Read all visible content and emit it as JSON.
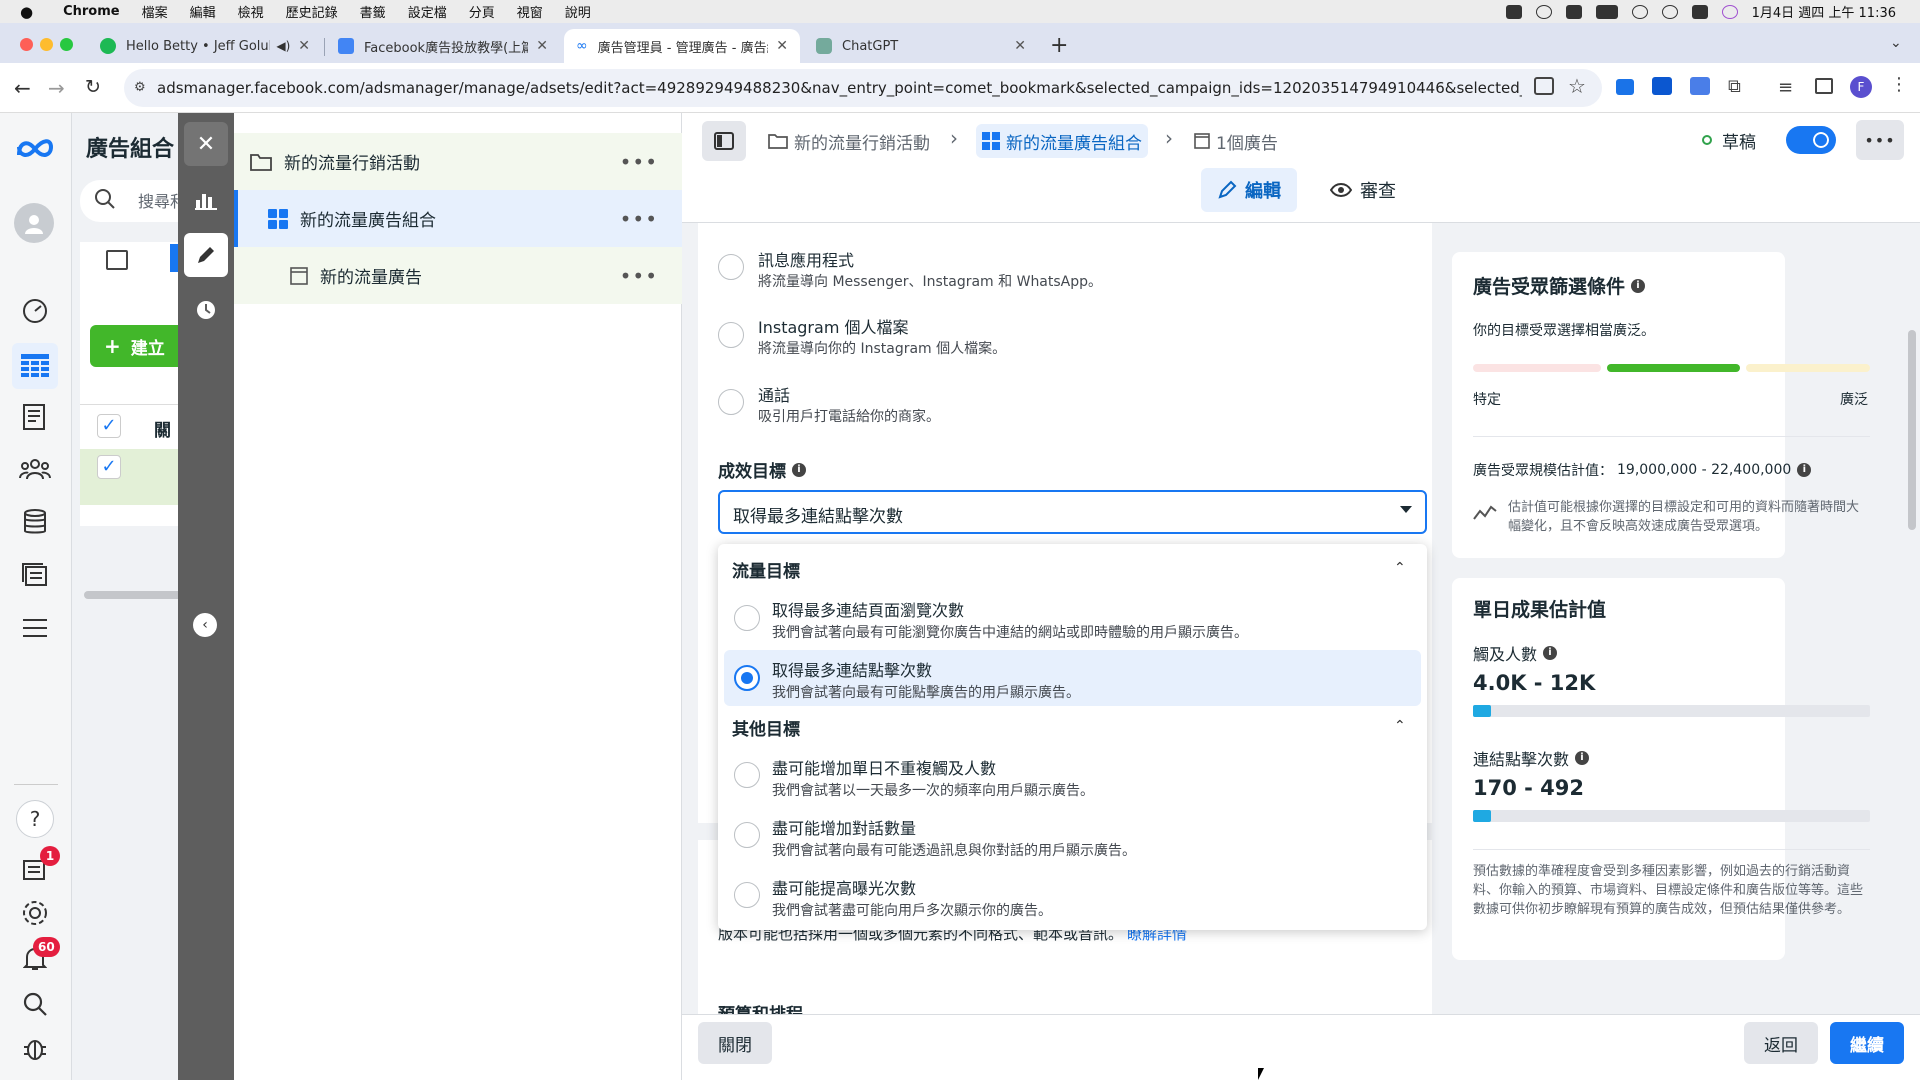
{
  "menubar": {
    "app": "Chrome",
    "items": [
      "檔案",
      "編輯",
      "檢視",
      "歷史記錄",
      "書籤",
      "設定檔",
      "分頁",
      "視窗",
      "說明"
    ],
    "datetime": "1月4日 週四 上午 11:36"
  },
  "tabs": [
    {
      "title": "Hello Betty • Jeff Golub"
    },
    {
      "title": "Facebook廣告投放教學(上篇)"
    },
    {
      "title": "廣告管理員 - 管理廣告 - 廣告組合"
    },
    {
      "title": "ChatGPT"
    }
  ],
  "address": {
    "url": "adsmanager.facebook.com/adsmanager/manage/adsets/edit?act=492892949488230&nav_entry_point=comet_bookmark&selected_campaign_ids=120203514794910446&selected_adset_ids=120203514..."
  },
  "profile_initial": "F",
  "rail": {
    "help": "?",
    "badge_notifications_small": "1",
    "badge_alerts": "60"
  },
  "background_panel": {
    "title": "廣告組合",
    "search_placeholder": "搜尋和",
    "create": "建立",
    "col": "關"
  },
  "tree": {
    "campaign": "新的流量行銷活動",
    "adset": "新的流量廣告組合",
    "ad": "新的流量廣告"
  },
  "breadcrumbs": {
    "campaign": "新的流量行銷活動",
    "adset": "新的流量廣告組合",
    "ads": "1個廣告"
  },
  "status": {
    "label": "草稿"
  },
  "modes": {
    "edit": "編輯",
    "review": "審查"
  },
  "destinations": [
    {
      "title": "訊息應用程式",
      "desc": "將流量導向 Messenger、Instagram 和 WhatsApp。"
    },
    {
      "title": "Instagram 個人檔案",
      "desc": "將流量導向你的 Instagram 個人檔案。"
    },
    {
      "title": "通話",
      "desc": "吸引用戶打電話給你的商家。"
    }
  ],
  "performance_goal": {
    "label": "成效目標",
    "selected": "取得最多連結點擊次數"
  },
  "menu": {
    "traffic_header": "流量目標",
    "traffic_options": [
      {
        "title": "取得最多連結頁面瀏覽次數",
        "desc": "我們會試著向最有可能瀏覽你廣告中連結的網站或即時體驗的用戶顯示廣告。"
      },
      {
        "title": "取得最多連結點擊次數",
        "desc": "我們會試著向最有可能點擊廣告的用戶顯示廣告。"
      }
    ],
    "other_header": "其他目標",
    "other_options": [
      {
        "title": "盡可能增加單日不重複觸及人數",
        "desc": "我們會試著以一天最多一次的頻率向用戶顯示廣告。"
      },
      {
        "title": "盡可能增加對話數量",
        "desc": "我們會試著向最有可能透過訊息與你對話的用戶顯示廣告。"
      },
      {
        "title": "盡可能提高曝光次數",
        "desc": "我們會試著盡可能向用戶多次顯示你的廣告。"
      }
    ]
  },
  "behind_text": {
    "text": "版本可能也括採用一個或多個元素的不同格式、範本或音訊。",
    "link": "瞭解詳情",
    "cut": "預算和排程"
  },
  "audience": {
    "title": "廣告受眾篩選條件",
    "subtitle": "你的目標受眾選擇相當廣泛。",
    "left": "特定",
    "right": "廣泛",
    "size_label": "廣告受眾規模估計值：",
    "size_value": "19,000,000 - 22,400,000",
    "note": "估計值可能根據你選擇的目標設定和可用的資料而隨著時間大幅變化，且不會反映高效速成廣告受眾選項。"
  },
  "daily": {
    "title": "單日成果估計值",
    "reach_label": "觸及人數",
    "reach_value": "4.0K - 12K",
    "reach_fill": 0.045,
    "clicks_label": "連結點擊次數",
    "clicks_value": "170 - 492",
    "clicks_fill": 0.045,
    "disclaimer": "預估數據的準確程度會受到多種因素影響，例如過去的行銷活動資料、你輸入的預算、市場資料、目標設定條件和廣告版位等等。這些數據可供你初步瞭解現有預算的廣告成效，但預估結果僅供參考。"
  },
  "footer": {
    "close": "關閉",
    "back": "返回",
    "continue": "繼續"
  },
  "colors": {
    "accent": "#1877f2",
    "green": "#42b72a",
    "draft": "#31a24c"
  }
}
